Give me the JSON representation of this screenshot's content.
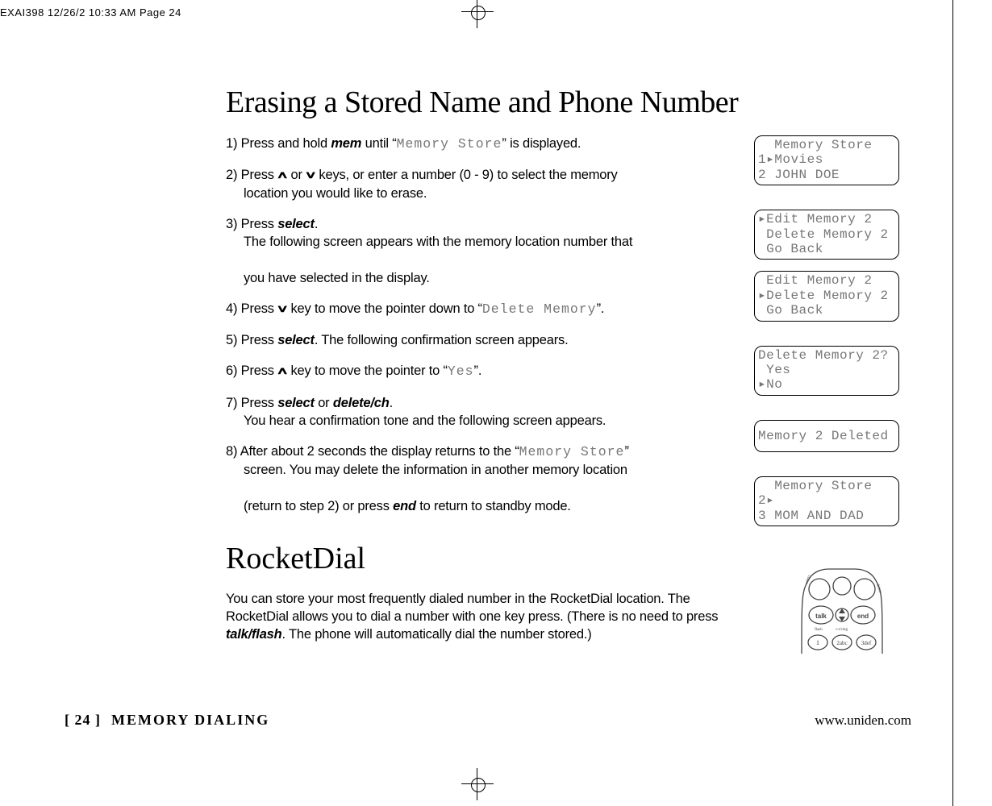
{
  "header": "EXAI398  12/26/2  10:33 AM  Page 24",
  "title1": "Erasing a Stored Name and Phone Number",
  "steps": {
    "s1a": "1) Press and hold ",
    "s1_kw": "mem",
    "s1b": " until “",
    "s1_lcd": "Memory Store",
    "s1c": "” is displayed.",
    "s2a": "2) Press ",
    "s2_up": "∧",
    "s2b": " or ",
    "s2_dn": "∨",
    "s2c": " keys, or enter a number (0 - 9) to select the memory",
    "s2d": "location you would like to erase.",
    "s3a": "3) Press ",
    "s3_kw": "select",
    "s3b": ".",
    "s3c": "The following screen appears with the memory location number that",
    "s3d": "you have selected in the display.",
    "s4a": "4) Press ",
    "s4_dn": "∨",
    "s4b": " key to move the pointer down to “",
    "s4_lcd": "Delete Memory",
    "s4c": "”.",
    "s5a": "5) Press ",
    "s5_kw": "select",
    "s5b": ". The following confirmation screen appears.",
    "s6a": "6) Press ",
    "s6_up": "∧",
    "s6b": " key to move the pointer to “",
    "s6_lcd": "Yes",
    "s6c": "”.",
    "s7a": "7) Press ",
    "s7_kw1": "select",
    "s7b": " or ",
    "s7_kw2": "delete/ch",
    "s7c": ".",
    "s7d": "You hear a confirmation tone and the following screen appears.",
    "s8a": "8) After about 2 seconds the display returns to the “",
    "s8_lcd": "Memory Store",
    "s8b": "”",
    "s8c": "screen. You may delete the information in another memory location",
    "s8d": "(return to step 2) or press ",
    "s8_kw": "end",
    "s8e": " to return to standby mode."
  },
  "title2": "RocketDial",
  "rocket_intro_a": "You can store your most frequently dialed number in the RocketDial location. The RocketDial allows you to dial a number with one key press. (There is no need to press ",
  "rocket_kw": "talk/flash",
  "rocket_intro_b": ". The phone will automatically dial the number stored.)",
  "lcds": {
    "l1": "  Memory Store\n1▸Movies\n2 JOHN DOE",
    "l2": "▸Edit Memory 2\n Delete Memory 2\n Go Back",
    "l3": " Edit Memory 2\n▸Delete Memory 2\n Go Back",
    "l4": "Delete Memory 2?\n Yes\n▸No",
    "l5": "Memory 2 Deleted",
    "l6": "  Memory Store\n2▸\n3 MOM AND DAD"
  },
  "footer": {
    "page": "[ 24 ]",
    "section": "MEMORY DIALING",
    "url": "www.uniden.com"
  }
}
